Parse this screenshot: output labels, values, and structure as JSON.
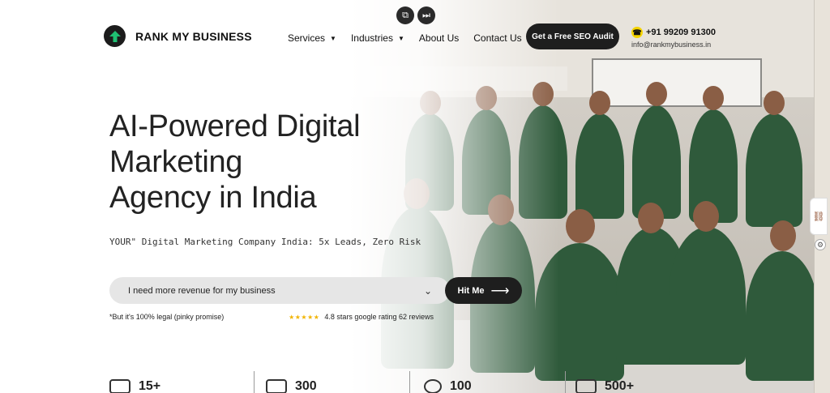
{
  "brand": {
    "name": "RANK MY BUSINESS",
    "accent": "#1fbf72",
    "dark": "#1e1e1e"
  },
  "nav": {
    "items": [
      {
        "label": "Services",
        "dropdown": true
      },
      {
        "label": "Industries",
        "dropdown": true
      },
      {
        "label": "About Us",
        "dropdown": false
      },
      {
        "label": "Contact Us",
        "dropdown": false
      }
    ]
  },
  "header": {
    "cta_label": "Get a Free SEO Audit",
    "phone": "+91 99209 91300",
    "email": "info@rankmybusiness.in"
  },
  "hero": {
    "title_line1": "AI-Powered Digital",
    "title_line2": "Marketing",
    "title_line3": "Agency in India",
    "subtitle": "YOUR\" Digital Marketing Company India: 5x Leads, Zero Risk",
    "select_value": "I need more revenue for my business",
    "submit_label": "Hit Me",
    "legal_note": "*But it's 100% legal (pinky promise)",
    "rating_text": "4.8 stars google rating 62 reviews",
    "stars": "★★★★★"
  },
  "stats": [
    {
      "value": "15+"
    },
    {
      "value": "300"
    },
    {
      "value": "100"
    },
    {
      "value": "500+"
    }
  ],
  "icons": {
    "logo": "up-arrow-icon",
    "phone": "phone-icon",
    "float1": "copy-icon",
    "float2": "skip-icon"
  }
}
